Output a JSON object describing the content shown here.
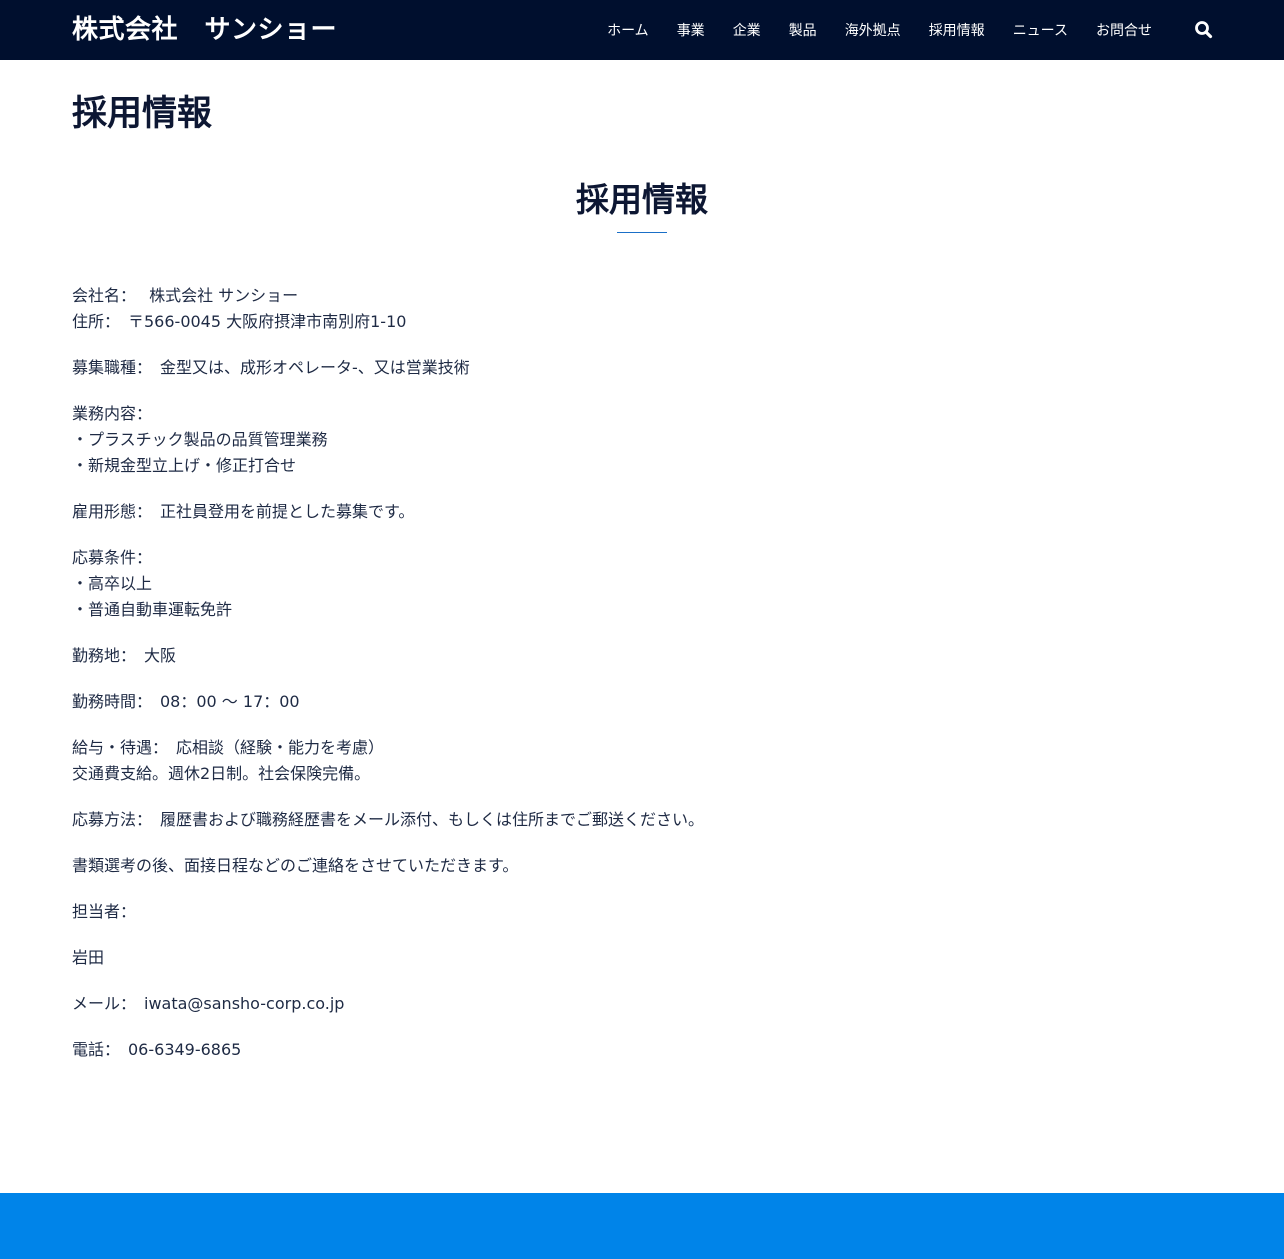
{
  "header": {
    "logo": "株式会社　サンショー",
    "nav": [
      "ホーム",
      "事業",
      "企業",
      "製品",
      "海外拠点",
      "採用情報",
      "ニュース",
      "お問合せ"
    ],
    "search_icon": "search-icon"
  },
  "page": {
    "title": "採用情報",
    "section_title": "採用情報"
  },
  "content": {
    "company": "会社名：　 株式会社 サンショー",
    "address": "住所：　〒566-0045 大阪府摂津市南別府1-10",
    "job_type": "募集職種：　金型又は、成形オペレータ-、又は営業技術",
    "duties_label": "業務内容：",
    "duties_1": "・プラスチック製品の品質管理業務",
    "duties_2": "・新規金型立上げ・修正打合せ",
    "employment": "雇用形態：　正社員登用を前提とした募集です。",
    "requirements_label": "応募条件：",
    "requirements_1": "・高卒以上",
    "requirements_2": "・普通自動車運転免許",
    "location": "勤務地：　大阪",
    "hours": "勤務時間：　08：00 ～ 17：00",
    "salary": "給与・待遇：　応相談（経験・能力を考慮）",
    "benefits": "交通費支給。週休2日制。社会保険完備。",
    "apply_method": "応募方法：　履歴書および職務経歴書をメール添付、もしくは住所までご郵送ください。",
    "selection": "書類選考の後、面接日程などのご連絡をさせていただきます。",
    "contact_label": "担当者：",
    "contact_name": "岩田",
    "email": "メール：　iwata@sansho-corp.co.jp",
    "phone": "電話：　06-6349-6865"
  },
  "colors": {
    "header_bg": "#000f2e",
    "footer_bg": "#0084e9",
    "accent": "#1a6fc7"
  }
}
